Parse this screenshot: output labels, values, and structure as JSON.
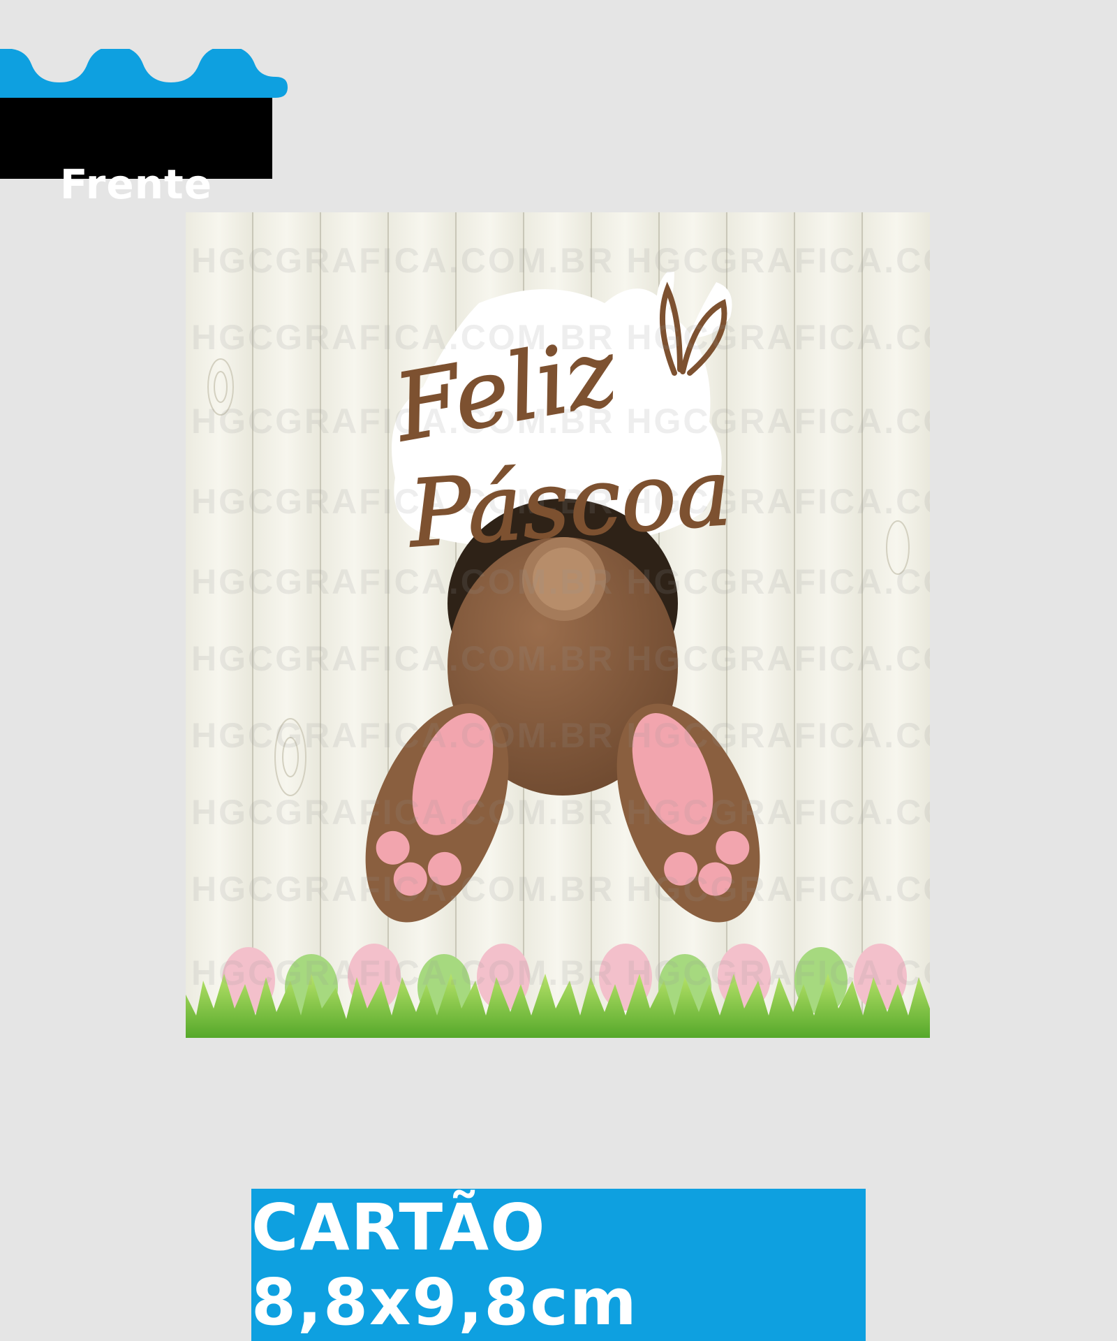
{
  "tag": {
    "label": "Frente",
    "wave_color": "#0ea0e0",
    "background": "#000000"
  },
  "card": {
    "greeting_line1": "Feliz",
    "greeting_line2": "Páscoa",
    "watermark": "HGCGRAFICA.COM.BR HGCGRAFICA.COM.BR",
    "illustration": "bunny-legs-in-hole-icon",
    "text_color": "#7d5130"
  },
  "size_label": {
    "text": "CARTÃO 8,8x9,8cm",
    "background": "#0ea0e0"
  }
}
